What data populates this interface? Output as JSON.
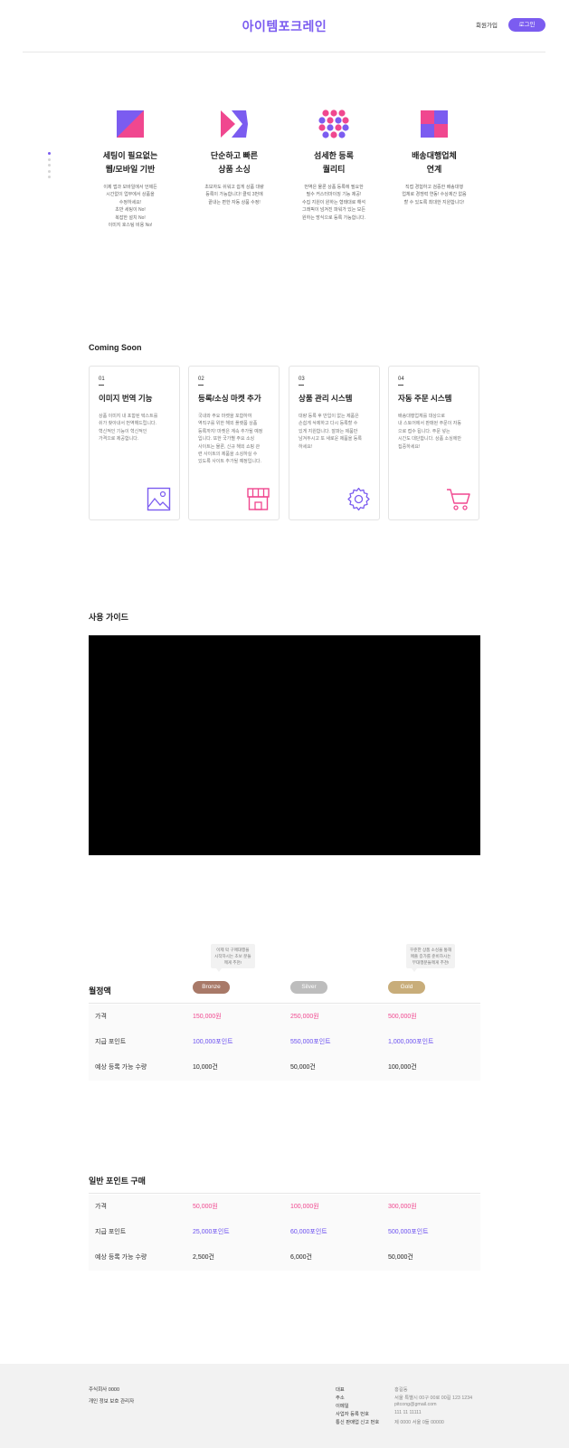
{
  "header": {
    "logo": "아이템포크레인",
    "signup": "회원가입",
    "login": "로그인"
  },
  "colors": {
    "accent": "#7b5cf0",
    "pink": "#f0478f",
    "bronze": "#a87968",
    "silver": "#bdbdbd",
    "gold": "#c8ad7a"
  },
  "features": [
    {
      "icon": "split-square-icon",
      "title": "세팅이 필요없는\n웹/모바일 기반",
      "desc": "이제 앱과 모바일에서 언제든\n시간없이 업무에서 상품을\n수정하세요!\n초반 세팅이 No!\n복잡한 설치 No!\n이미지 호스팅 비용 No!"
    },
    {
      "icon": "arrow-chevron-icon",
      "title": "단순하고 빠른\n상품 소싱",
      "desc": "초보자도 쉬워고 쉽게 상품 대량\n등록이 가능합니다! 클릭 3번에\n끝내는 편한 자동 상품 수정!"
    },
    {
      "icon": "dots-grid-icon",
      "title": "섬세한 등록\n퀄리티",
      "desc": "번역은 물론 상품 등록에 필요한\n필수 커스터마이징 기능 제공!\n수집 지원이 원하는 형태대로 해석\n그래픽이 넘겨진 파워가 있는 모든\n원하는 방식으로 등록 가능합니다."
    },
    {
      "icon": "checker-square-icon",
      "title": "배송대행업체\n연계",
      "desc": "직접 경험하고 검증한 배송대행\n업체로 경쟁력 연동! 수상제간 없음\n할 수 있도록 최대한 지원합니다!"
    }
  ],
  "coming_soon": {
    "title": "Coming Soon",
    "cards": [
      {
        "num": "01",
        "title": "이미지 번역 기능",
        "desc": "상품 이미지 내 포함된 텍스트를\n쉬가 찾아내서 번역해드립니다.\n혁신적인 기능이 혁신적인\n가격으로 제공합니다.",
        "icon": "image-icon"
      },
      {
        "num": "02",
        "title": "등록/소싱 마켓 추가",
        "desc": "국내와 주요 마켓을 포함하여\n역직구를 위한 해외 플랫폼 상품\n등록까지! 마켓은 계속 추가될 예정\n입니다. 또한 국가별 주요 소싱\n사이트는 물론, 신규 해외 쇼핑 관\n련 사이트의 제품을 소싱하실 수\n있도록 사이트 추가될 예정입니다.",
        "icon": "store-icon"
      },
      {
        "num": "03",
        "title": "상품 관리 시스템",
        "desc": "대량 등록 후 반입이 없는 제품은\n손쉽게 삭제하고 다시 등록할 수\n있게 지원합니다. 잘파는 제품만\n남겨두시고 또 새로운 제품을 등록\n하세요!",
        "icon": "gear-icon"
      },
      {
        "num": "04",
        "title": "자동 주문 시스템",
        "desc": "배송대행업체를 대상으로\n내 스토어에서 판매된 주문이 자동\n으로 접수 됩니다. 주문 넣는\n시간도 대단합니다. 상품 소싱에만\n집중하세요!",
        "icon": "cart-icon"
      }
    ]
  },
  "guide": {
    "title": "사용 가이드"
  },
  "monthly": {
    "title": "월정액",
    "tips": [
      "이제 막 구매대행을\n시작하시는 초보 분들\n께게 추천!",
      "꾸준한 상품 소싱을 통해\n매출 증가를 준비하시는\n부대행분들께게 추천!"
    ],
    "plans": [
      "Bronze",
      "Silver",
      "Gold"
    ],
    "rows": [
      {
        "label": "가격",
        "values": [
          "150,000원",
          "250,000원",
          "500,000원"
        ],
        "style": "pink"
      },
      {
        "label": "지급 포인트",
        "values": [
          "100,000포인트",
          "550,000포인트",
          "1,000,000포인트"
        ],
        "style": "purple"
      },
      {
        "label": "예상 등록 가능 수량",
        "values": [
          "10,000건",
          "50,000건",
          "100,000건"
        ],
        "style": "dark"
      }
    ]
  },
  "points": {
    "title": "일반 포인트 구매",
    "rows": [
      {
        "label": "가격",
        "values": [
          "50,000원",
          "100,000원",
          "300,000원"
        ],
        "style": "pink"
      },
      {
        "label": "지급 포인트",
        "values": [
          "25,000포인트",
          "60,000포인트",
          "500,000포인트"
        ],
        "style": "purple"
      },
      {
        "label": "예상 등록 가능 수량",
        "values": [
          "2,500건",
          "6,000건",
          "50,000건"
        ],
        "style": "dark"
      }
    ]
  },
  "footer": {
    "company": "주식회사 0000",
    "privacy": "개인 정보 보호 관리자",
    "info": [
      {
        "key": "대표",
        "value": "홍길동"
      },
      {
        "key": "주소",
        "value": "서울 특별시 00구 00로 00길 123 1234"
      },
      {
        "key": "이메일",
        "value": "pitcong@gmail.com"
      },
      {
        "key": "사업자 등록 번호",
        "value": "111 11 11111"
      },
      {
        "key": "통신 판매업 신고 번호",
        "value": "제 0000 서울 0들 00000"
      }
    ]
  }
}
